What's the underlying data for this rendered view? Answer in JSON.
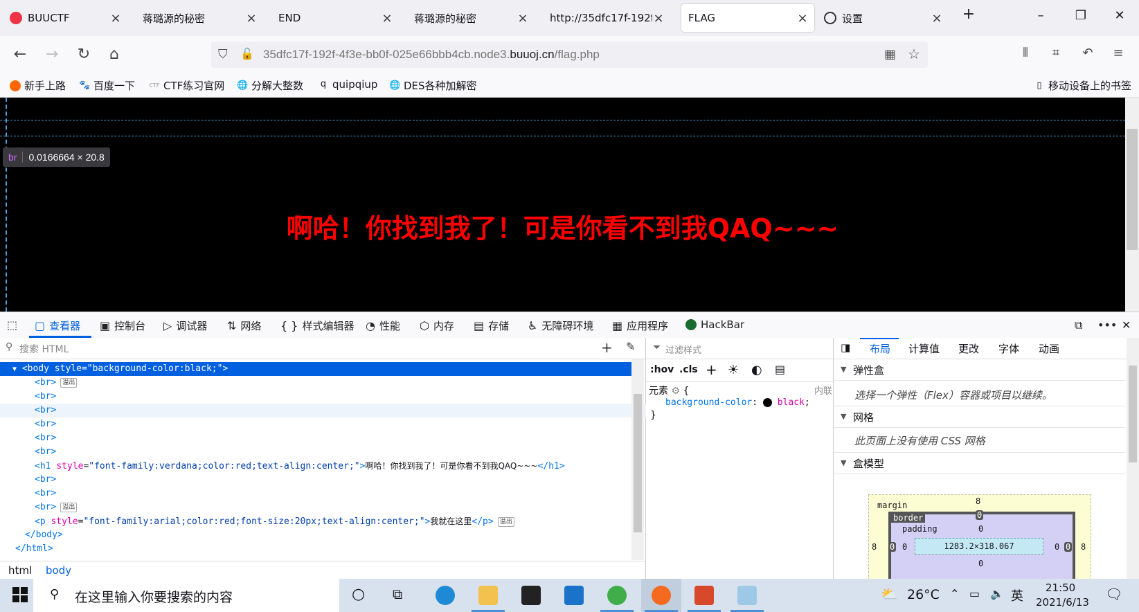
{
  "tabs": [
    {
      "title": "BUUCTF",
      "icon": "buuctf-icon"
    },
    {
      "title": "蒋璐源的秘密",
      "icon": ""
    },
    {
      "title": "END",
      "icon": ""
    },
    {
      "title": "蒋璐源的秘密",
      "icon": ""
    },
    {
      "title": "http://35dfc17f-192f-",
      "icon": ""
    },
    {
      "title": "FLAG",
      "icon": "",
      "active": true
    },
    {
      "title": "设置",
      "icon": "gear-icon"
    }
  ],
  "url": {
    "prefix": "35dfc17f-192f-4f3e-bb0f-025e66bbb4cb.node3.",
    "domain": "buuoj.cn",
    "path": "/flag.php"
  },
  "bookmarks": [
    "新手上路",
    "百度一下",
    "CTF练习官网",
    "分解大整数",
    "quipqiup",
    "DES各种加解密"
  ],
  "mobile_bookmarks": "移动设备上的书签",
  "page": {
    "heading": "啊哈！你找到我了！可是你看不到我QAQ~~~"
  },
  "tooltip": {
    "tag": "br",
    "dims": "0.0166664 × 20.8"
  },
  "devtools": {
    "tabs": [
      "查看器",
      "控制台",
      "调试器",
      "网络",
      "样式编辑器",
      "性能",
      "内存",
      "存储",
      "无障碍环境",
      "应用程序",
      "HackBar"
    ],
    "search_placeholder": "搜索 HTML",
    "badge": "溢出",
    "code": {
      "body_open": "<body",
      "body_attr": "style",
      "body_val": "\"background-color:black;\"",
      "br": "<br>",
      "h1_open": "<h1",
      "h1_attr": "style",
      "h1_val": "\"font-family:verdana;color:red;text-align:center;\"",
      "h1_text": "啊哈！你找到我了！可是你看不到我QAQ~~~",
      "h1_close": "</h1>",
      "p_open": "<p",
      "p_attr": "style",
      "p_val": "\"font-family:arial;color:red;font-size:20px;text-align:center;\"",
      "p_text": "我就在这里",
      "p_close": "</p>",
      "body_close": "</body>",
      "html_close": "</html>"
    },
    "breadcrumbs": [
      "html",
      "body"
    ],
    "rules": {
      "filter_placeholder": "过滤样式",
      "hov": ":hov",
      "cls": ".cls",
      "element_label": "元素",
      "inline_label": "内联",
      "prop": "background-color",
      "value": "black"
    },
    "layout_tabs": [
      "布局",
      "计算值",
      "更改",
      "字体",
      "动画"
    ],
    "layout": {
      "flex_title": "弹性盒",
      "flex_note": "选择一个弹性（Flex）容器或项目以继续。",
      "grid_title": "网格",
      "grid_note": "此页面上没有使用 CSS 网格",
      "box_title": "盒模型",
      "margin_label": "margin",
      "border_label": "border",
      "padding_label": "padding",
      "margin_top": "8",
      "margin_left": "8",
      "margin_right": "8",
      "border_top": "0",
      "border_left": "0",
      "border_right": "0",
      "padding_top": "0",
      "padding_left": "0",
      "padding_right": "0",
      "padding_bottom": "0",
      "content_size": "1283.2×318.067"
    }
  },
  "taskbar": {
    "search_text": "在这里输入你要搜索的内容",
    "temperature": "26°C",
    "ime": "英",
    "time": "21:50",
    "date": "2021/6/13"
  }
}
